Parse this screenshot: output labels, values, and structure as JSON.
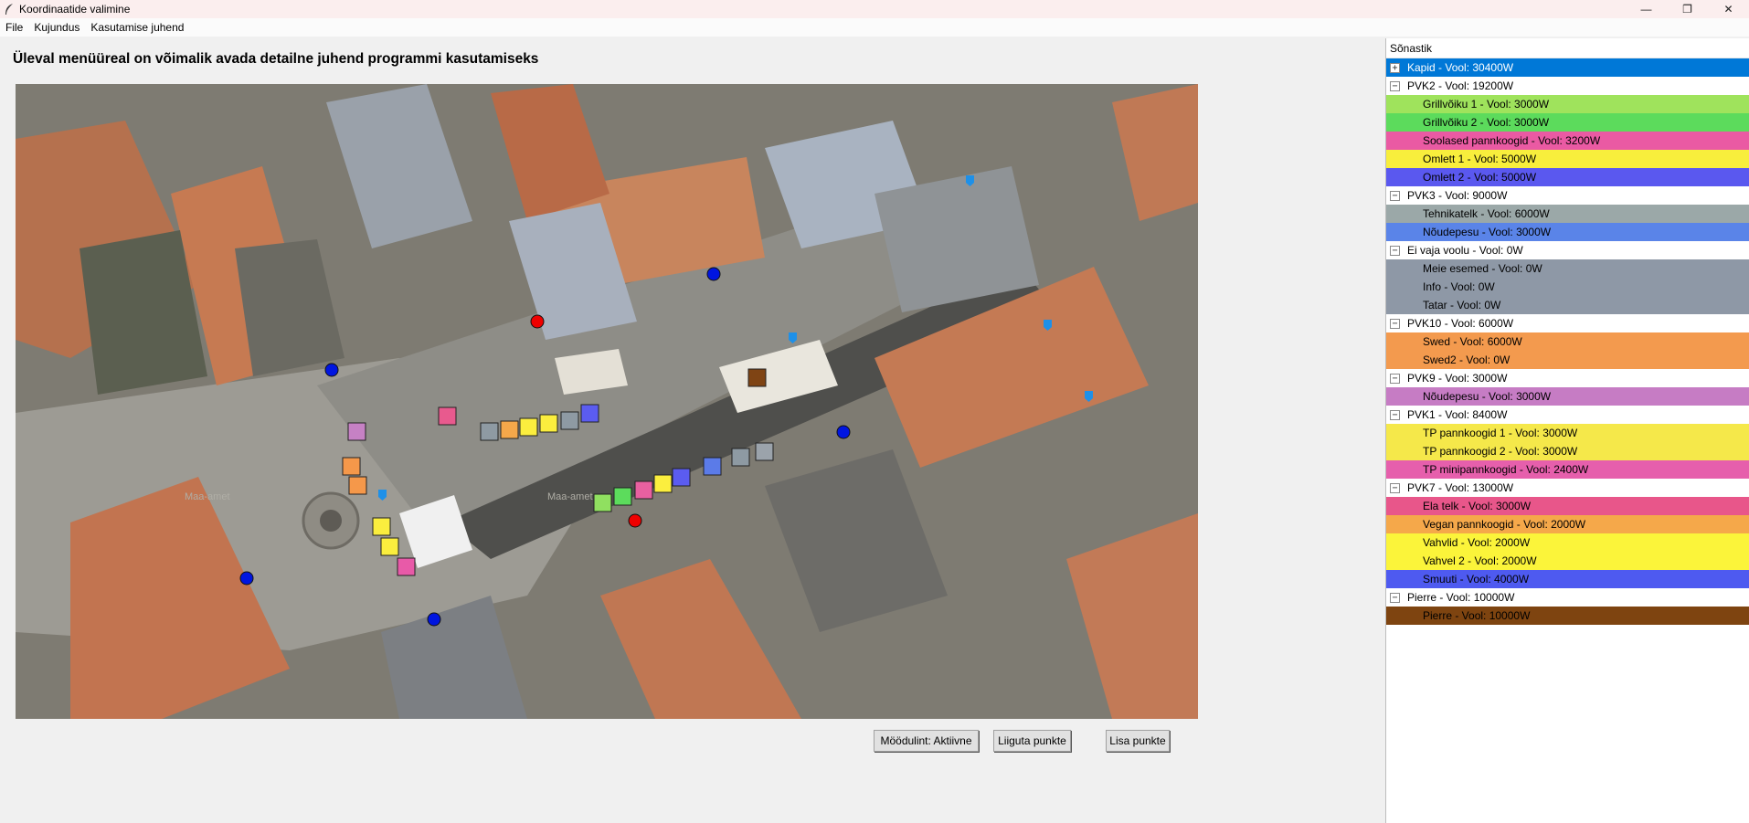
{
  "window": {
    "title": "Koordinaatide valimine",
    "controls": {
      "minimize": "—",
      "maximize": "❐",
      "close": "✕"
    }
  },
  "menu": [
    "File",
    "Kujundus",
    "Kasutamise juhend"
  ],
  "heading": "Üleval menüüreal on võimalik avada detailne juhend programmi kasutamiseks",
  "map": {
    "watermarks": [
      "Maa-amet",
      "Maa-amet"
    ],
    "squares": [
      {
        "color": "#c681c4"
      },
      {
        "color": "#e85a8e"
      },
      {
        "color": "#8e9aa3"
      },
      {
        "color": "#f5a84a"
      },
      {
        "color": "#fbee3e"
      },
      {
        "color": "#fbee3e"
      },
      {
        "color": "#8e9aa3"
      },
      {
        "color": "#5b5cf0"
      },
      {
        "color": "#f5984a"
      },
      {
        "color": "#f5984a"
      },
      {
        "color": "#fbee3e"
      },
      {
        "color": "#fbee3e"
      },
      {
        "color": "#e85aa8"
      },
      {
        "color": "#90e060"
      },
      {
        "color": "#5cdc5c"
      },
      {
        "color": "#e860a0"
      },
      {
        "color": "#fbee3e"
      },
      {
        "color": "#5b5cf0"
      },
      {
        "color": "#5b7be8"
      },
      {
        "color": "#8e9aa3"
      },
      {
        "color": "#9ba3ab"
      },
      {
        "color": "#7f4414"
      }
    ],
    "dots": [
      {
        "color": "#0015e0"
      },
      {
        "color": "#0015e0"
      },
      {
        "color": "#0015e0"
      },
      {
        "color": "#0015e0"
      },
      {
        "color": "#0015e0"
      },
      {
        "color": "#ef0000"
      },
      {
        "color": "#ef0000"
      }
    ],
    "pins": [
      {
        "color": "#1e90e8"
      },
      {
        "color": "#1e90e8"
      },
      {
        "color": "#1e90e8"
      },
      {
        "color": "#1e90e8"
      },
      {
        "color": "#1e90e8"
      }
    ]
  },
  "buttons": {
    "modulint": "Möödulint: Aktiivne",
    "liiguta": "Liiguta punkte",
    "lisa": "Lisa punkte"
  },
  "panel": {
    "header": "Sõnastik",
    "rows": [
      {
        "type": "group",
        "toggle": "+",
        "label": "Kapid - Vool: 30400W",
        "selected": true
      },
      {
        "type": "group",
        "toggle": "−",
        "label": "PVK2 - Vool: 19200W"
      },
      {
        "type": "child",
        "label": "Grillvõiku 1 - Vool: 3000W",
        "color": "#9fe35c"
      },
      {
        "type": "child",
        "label": "Grillvõiku 2 - Vool: 3000W",
        "color": "#5cdb5c"
      },
      {
        "type": "child",
        "label": "Soolased pannkoogid - Vool: 3200W",
        "color": "#ea5aa3"
      },
      {
        "type": "child",
        "label": "Omlett 1 - Vool: 5000W",
        "color": "#f8ee3c"
      },
      {
        "type": "child",
        "label": "Omlett 2 - Vool: 5000W",
        "color": "#5a58ef"
      },
      {
        "type": "group",
        "toggle": "−",
        "label": "PVK3 - Vool: 9000W"
      },
      {
        "type": "child",
        "label": "Tehnikatelk - Vool: 6000W",
        "color": "#9ba8a8"
      },
      {
        "type": "child",
        "label": "Nõudepesu - Vool: 3000W",
        "color": "#5a84e8"
      },
      {
        "type": "group",
        "toggle": "−",
        "label": "Ei vaja voolu - Vool: 0W"
      },
      {
        "type": "child",
        "label": "Meie esemed - Vool: 0W",
        "color": "#8e98a6"
      },
      {
        "type": "child",
        "label": "Info - Vool: 0W",
        "color": "#8e98a6"
      },
      {
        "type": "child",
        "label": "Tatar - Vool: 0W",
        "color": "#8e98a6"
      },
      {
        "type": "group",
        "toggle": "−",
        "label": "PVK10 - Vool: 6000W"
      },
      {
        "type": "child",
        "label": "Swed - Vool: 6000W",
        "color": "#f39a4e"
      },
      {
        "type": "child",
        "label": "Swed2 - Vool: 0W",
        "color": "#f39a4e"
      },
      {
        "type": "group",
        "toggle": "−",
        "label": "PVK9 - Vool: 3000W"
      },
      {
        "type": "child",
        "label": "Nõudepesu - Vool: 3000W",
        "color": "#c67cc4"
      },
      {
        "type": "group",
        "toggle": "−",
        "label": "PVK1 - Vool: 8400W"
      },
      {
        "type": "child",
        "label": "TP pannkoogid 1 - Vool: 3000W",
        "color": "#f5e84a"
      },
      {
        "type": "child",
        "label": "TP pannkoogid 2 - Vool: 3000W",
        "color": "#f5e84a"
      },
      {
        "type": "child",
        "label": "TP minipannkoogid - Vool: 2400W",
        "color": "#e65fac"
      },
      {
        "type": "group",
        "toggle": "−",
        "label": "PVK7 - Vool: 13000W"
      },
      {
        "type": "child",
        "label": "Ela telk - Vool: 3000W",
        "color": "#e8568a"
      },
      {
        "type": "child",
        "label": "Vegan pannkoogid - Vool: 2000W",
        "color": "#f5a84a"
      },
      {
        "type": "child",
        "label": "Vahvlid - Vool: 2000W",
        "color": "#fbf43a"
      },
      {
        "type": "child",
        "label": "Vahvel 2 - Vool: 2000W",
        "color": "#fbf43a"
      },
      {
        "type": "child",
        "label": "Smuuti - Vool: 4000W",
        "color": "#4e5af0"
      },
      {
        "type": "group",
        "toggle": "−",
        "label": "Pierre - Vool: 10000W"
      },
      {
        "type": "child",
        "label": "Pierre - Vool: 10000W",
        "color": "#7e4410"
      }
    ]
  }
}
